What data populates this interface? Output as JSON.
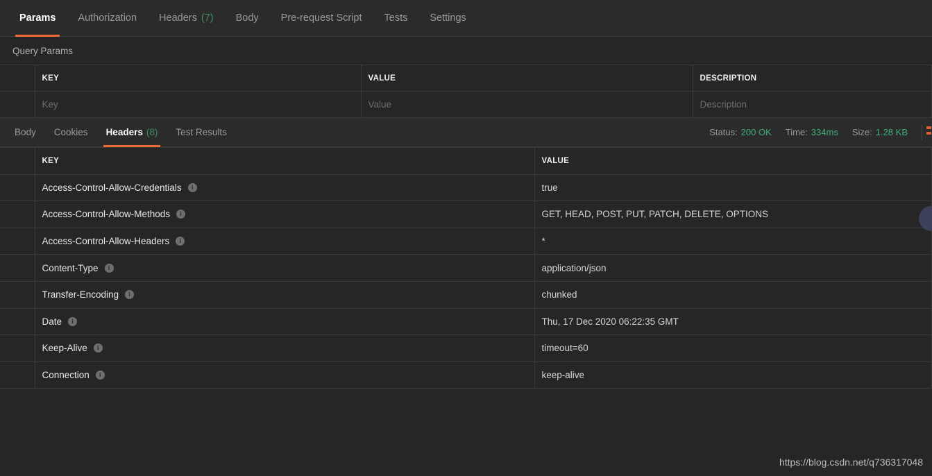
{
  "request_tabs": [
    {
      "label": "Params",
      "count": null,
      "active": true
    },
    {
      "label": "Authorization",
      "count": null,
      "active": false
    },
    {
      "label": "Headers",
      "count": "(7)",
      "active": false
    },
    {
      "label": "Body",
      "count": null,
      "active": false
    },
    {
      "label": "Pre-request Script",
      "count": null,
      "active": false
    },
    {
      "label": "Tests",
      "count": null,
      "active": false
    },
    {
      "label": "Settings",
      "count": null,
      "active": false
    }
  ],
  "query_params": {
    "title": "Query Params",
    "columns": [
      "KEY",
      "VALUE",
      "DESCRIPTION"
    ],
    "placeholder_row": {
      "key": "Key",
      "value": "Value",
      "description": "Description"
    }
  },
  "response": {
    "tabs": [
      {
        "label": "Body",
        "count": null,
        "active": false
      },
      {
        "label": "Cookies",
        "count": null,
        "active": false
      },
      {
        "label": "Headers",
        "count": "(8)",
        "active": true
      },
      {
        "label": "Test Results",
        "count": null,
        "active": false
      }
    ],
    "meta": {
      "status_label": "Status:",
      "status_value": "200 OK",
      "time_label": "Time:",
      "time_value": "334ms",
      "size_label": "Size:",
      "size_value": "1.28 KB"
    },
    "headers_table": {
      "columns": [
        "KEY",
        "VALUE"
      ],
      "rows": [
        {
          "key": "Access-Control-Allow-Credentials",
          "value": "true"
        },
        {
          "key": "Access-Control-Allow-Methods",
          "value": "GET, HEAD, POST, PUT, PATCH, DELETE, OPTIONS"
        },
        {
          "key": "Access-Control-Allow-Headers",
          "value": "*"
        },
        {
          "key": "Content-Type",
          "value": "application/json"
        },
        {
          "key": "Transfer-Encoding",
          "value": "chunked"
        },
        {
          "key": "Date",
          "value": "Thu, 17 Dec 2020 06:22:35 GMT"
        },
        {
          "key": "Keep-Alive",
          "value": "timeout=60"
        },
        {
          "key": "Connection",
          "value": "keep-alive"
        }
      ]
    }
  },
  "watermark": "https://blog.csdn.net/q736317048",
  "icons": {
    "info": "i",
    "info_name": "info-icon"
  },
  "colors": {
    "accent": "#f06a35",
    "success": "#3fb07a",
    "background": "#262626",
    "panel": "#2b2b2b",
    "border": "#3a3a3a"
  }
}
